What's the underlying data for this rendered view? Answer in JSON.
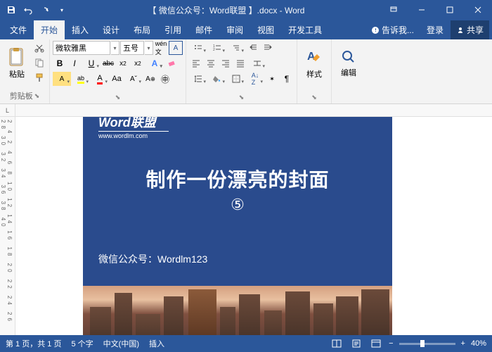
{
  "titlebar": {
    "title": "【 微信公众号：Word联盟 】.docx - Word"
  },
  "tabs": {
    "file": "文件",
    "home": "开始",
    "insert": "插入",
    "design": "设计",
    "layout": "布局",
    "references": "引用",
    "mailings": "邮件",
    "review": "审阅",
    "view": "视图",
    "developer": "开发工具",
    "tellme": "告诉我...",
    "login": "登录",
    "share": "共享"
  },
  "ribbon": {
    "font_name": "微软雅黑",
    "font_size": "五号",
    "paste": "粘贴",
    "clipboard": "剪贴板",
    "styles": "样式",
    "editing": "编辑"
  },
  "document": {
    "logo_text": "Word联盟",
    "logo_url": "www.wordlm.com",
    "cover_title": "制作一份漂亮的封面",
    "cover_number": "⑤",
    "cover_footer": "微信公众号：Wordlm123",
    "ruler_corner": "L",
    "ruler_v": "2 4   2 4 6 8 10 12 14 16 18 20 22 24 26 28 30 32 34 36 38 40"
  },
  "statusbar": {
    "page": "第 1 页，共 1 页",
    "words": "5 个字",
    "lang": "中文(中国)",
    "insert_mode": "插入",
    "zoom": "40%"
  }
}
